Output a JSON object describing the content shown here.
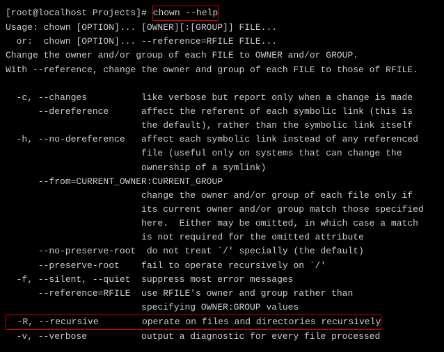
{
  "prompt": "[root@localhost Projects]# ",
  "command": "chown --help",
  "usage1": "Usage: chown [OPTION]... [OWNER][:[GROUP]] FILE...",
  "usage2": "  or:  chown [OPTION]... --reference=RFILE FILE...",
  "desc1": "Change the owner and/or group of each FILE to OWNER and/or GROUP.",
  "desc2": "With --reference, change the owner and group of each FILE to those of RFILE.",
  "opt_c": "  -c, --changes          like verbose but report only when a change is made",
  "opt_deref1": "      --dereference      affect the referent of each symbolic link (this is",
  "opt_deref2": "                         the default), rather than the symbolic link itself",
  "opt_h1": "  -h, --no-dereference   affect each symbolic link instead of any referenced",
  "opt_h2": "                         file (useful only on systems that can change the",
  "opt_h3": "                         ownership of a symlink)",
  "opt_from0": "      --from=CURRENT_OWNER:CURRENT_GROUP",
  "opt_from1": "                         change the owner and/or group of each file only if",
  "opt_from2": "                         its current owner and/or group match those specified",
  "opt_from3": "                         here.  Either may be omitted, in which case a match",
  "opt_from4": "                         is not required for the omitted attribute",
  "opt_nopreserve": "      --no-preserve-root  do not treat `/' specially (the default)",
  "opt_preserve": "      --preserve-root    fail to operate recursively on `/'",
  "opt_f": "  -f, --silent, --quiet  suppress most error messages",
  "opt_ref1": "      --reference=RFILE  use RFILE's owner and group rather than",
  "opt_ref2": "                         specifying OWNER:GROUP values",
  "opt_R": "  -R, --recursive        operate on files and directories recursively",
  "opt_v": "  -v, --verbose          output a diagnostic for every file processed"
}
